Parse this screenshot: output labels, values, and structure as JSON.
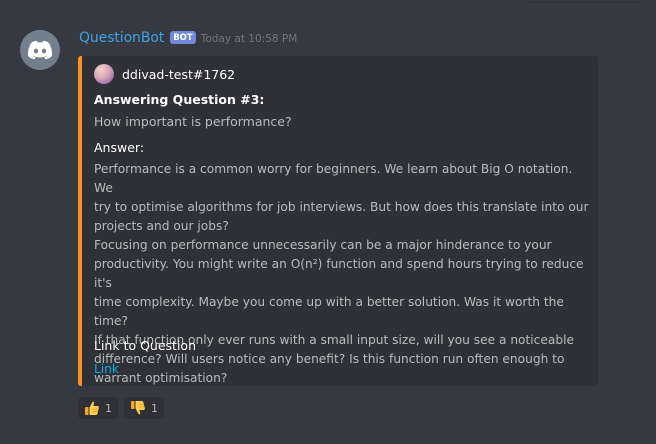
{
  "message": {
    "username": "QuestionBot",
    "bot_tag": "BOT",
    "timestamp": "Today at 10:58 PM",
    "avatar_icon": "discord-logo-icon",
    "accent_color": "#3ea2e5"
  },
  "embed": {
    "border_color": "#f7941d",
    "author": {
      "name": "ddivad-test#1762",
      "icon": "user-avatar-icon"
    },
    "title": "Answering Question #3:",
    "description": "How important is performance?",
    "fields": {
      "answer_name": "Answer:",
      "answer_lines": [
        "Performance is a common worry for beginners. We learn about Big O notation. We",
        "try to optimise algorithms for job interviews. But how does this translate into our",
        "projects and our jobs?",
        "Focusing on performance unnecessarily can be a major hinderance to your",
        "productivity. You might write an O(n²) function and spend hours trying to reduce it's",
        "time complexity. Maybe you come up with a better solution. Was it worth the time?",
        "If that function only ever runs with a small input size, will you see a noticeable",
        "difference? Will users notice any benefit? Is this function run often enough to",
        "warrant optimisation?"
      ],
      "link_name": "Link to Question",
      "link_value": "Link"
    }
  },
  "reactions": [
    {
      "emoji": "thumbs-up-icon",
      "count": "1"
    },
    {
      "emoji": "thumbs-down-icon",
      "count": "1"
    }
  ]
}
